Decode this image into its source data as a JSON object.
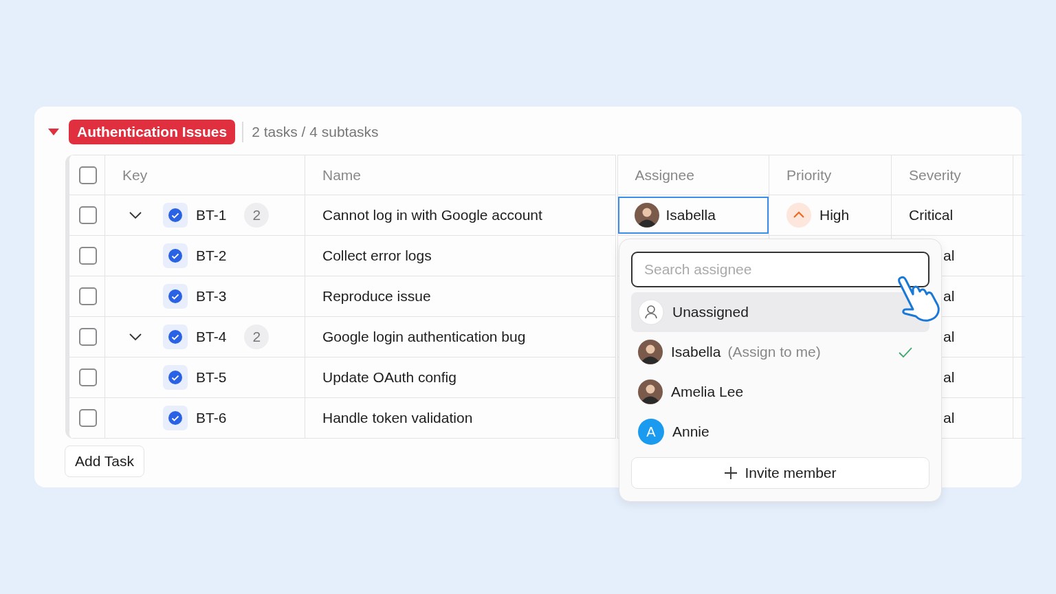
{
  "group": {
    "title": "Authentication Issues",
    "summary": "2 tasks / 4 subtasks",
    "expanded": true
  },
  "table": {
    "header_checked": false,
    "columns": [
      "Key",
      "Name",
      "Assignee",
      "Priority",
      "Severity"
    ],
    "rows": [
      {
        "checked": false,
        "key": "BT-1",
        "subtask_count": "2",
        "expanded": true,
        "name": "Cannot log in with Google account",
        "assignee": {
          "name": "Isabella",
          "editing": true
        },
        "priority": "High",
        "severity": "Critical",
        "severity_partial": false,
        "children": [
          {
            "checked": false,
            "key": "BT-2",
            "name": "Collect error logs",
            "severity": "al",
            "severity_partial": true
          },
          {
            "checked": false,
            "key": "BT-3",
            "name": "Reproduce issue",
            "severity": "al",
            "severity_partial": true
          }
        ]
      },
      {
        "checked": false,
        "key": "BT-4",
        "subtask_count": "2",
        "expanded": true,
        "name": "Google login authentication bug",
        "severity": "al",
        "severity_partial": true,
        "children": [
          {
            "checked": false,
            "key": "BT-5",
            "name": "Update OAuth config",
            "severity": "al",
            "severity_partial": true
          },
          {
            "checked": false,
            "key": "BT-6",
            "name": "Handle token validation",
            "severity": "al",
            "severity_partial": true
          }
        ]
      }
    ]
  },
  "add_button": "Add Task",
  "assignee_menu": {
    "search": {
      "placeholder": "Search assignee"
    },
    "options": [
      {
        "kind": "none",
        "name": "Unassigned",
        "highlighted": true,
        "selected": false
      },
      {
        "kind": "person",
        "name": "Isabella",
        "note": "(Assign to me)",
        "highlighted": false,
        "selected": true
      },
      {
        "kind": "person",
        "name": "Amelia Lee",
        "highlighted": false,
        "selected": false
      },
      {
        "kind": "initial",
        "name": "Annie",
        "initial": "A",
        "highlighted": false,
        "selected": false
      }
    ],
    "footer_button": "Invite member"
  }
}
